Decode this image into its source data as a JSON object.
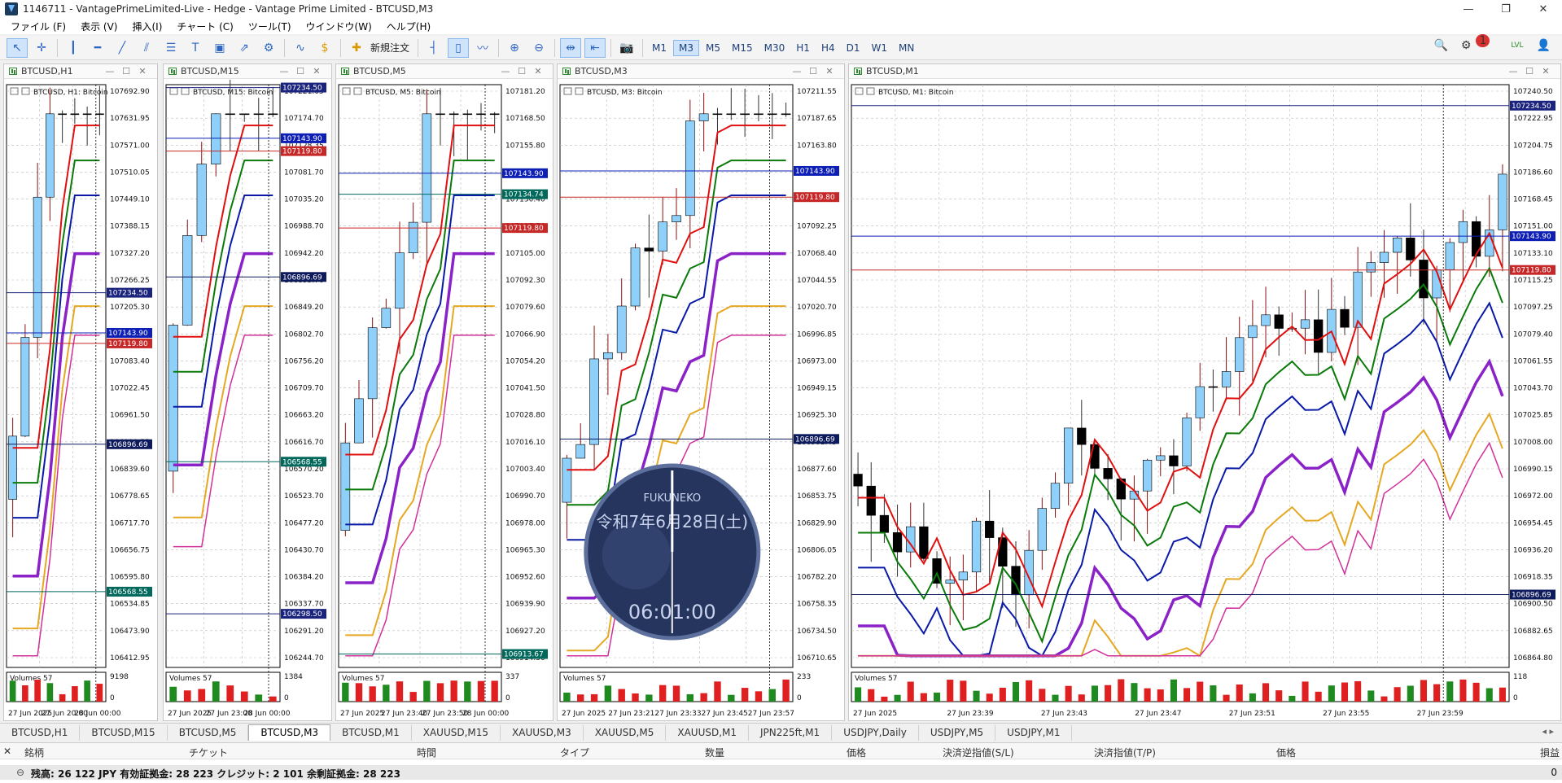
{
  "window": {
    "title": "1146711 - VantagePrimeLimited-Live - Hedge - Vantage Prime Limited - BTCUSD,M3",
    "minimize": "—",
    "maximize": "❐",
    "close": "✕"
  },
  "menu": [
    "ファイル (F)",
    "表示 (V)",
    "挿入(I)",
    "チャート (C)",
    "ツール(T)",
    "ウインドウ(W)",
    "ヘルプ(H)"
  ],
  "toolbar": {
    "new_order_label": "新規注文",
    "timeframes": [
      "M1",
      "M3",
      "M5",
      "M15",
      "M30",
      "H1",
      "H4",
      "D1",
      "W1",
      "MN"
    ],
    "active_timeframe": "M3",
    "notification_count": "1",
    "lvl_label": "LVL"
  },
  "charts": [
    {
      "window_title": "BTCUSD,H1",
      "sub_title": "BTCUSD, H1:  Bitcoin",
      "prices": [
        "107692.90",
        "107631.95",
        "107571.00",
        "107510.05",
        "107449.10",
        "107388.15",
        "107327.20",
        "107266.25",
        "107205.30",
        "107144.35",
        "107083.40",
        "107022.45",
        "106961.50",
        "106900.55",
        "106839.60",
        "106778.65",
        "106717.70",
        "106656.75",
        "106595.80",
        "106534.85",
        "106473.90",
        "106412.95"
      ],
      "tags": [
        {
          "t": "107234.50",
          "c": "#1a237e",
          "y": 0.357
        },
        {
          "t": "107143.90",
          "c": "#0d1fb5",
          "y": 0.426
        },
        {
          "t": "107119.80",
          "c": "#c62828",
          "y": 0.444
        },
        {
          "t": "106896.69",
          "c": "#0d1a5c",
          "y": 0.617
        },
        {
          "t": "106568.55",
          "c": "#00695c",
          "y": 0.87
        }
      ],
      "vol_label": "Volumes 57",
      "vol_max": "9198",
      "vol_min": "0",
      "times": [
        "27 Jun 2025",
        "27 Jun 20:00",
        "28 Jun 00:00"
      ]
    },
    {
      "window_title": "BTCUSD,M15",
      "sub_title": "BTCUSD, M15:  Bitcoin",
      "prices": [
        "107221.05",
        "107174.70",
        "107128.35",
        "107081.70",
        "107035.20",
        "106988.70",
        "106942.20",
        "106895.70",
        "106849.20",
        "106802.70",
        "106756.20",
        "106709.70",
        "106663.20",
        "106616.70",
        "106570.20",
        "106523.70",
        "106477.20",
        "106430.70",
        "106384.20",
        "106337.70",
        "106291.20",
        "106244.70"
      ],
      "tags": [
        {
          "t": "107234.50",
          "c": "#1a237e",
          "y": 0.005
        },
        {
          "t": "107143.90",
          "c": "#0d1fb5",
          "y": 0.092
        },
        {
          "t": "107119.80",
          "c": "#c62828",
          "y": 0.114
        },
        {
          "t": "106896.69",
          "c": "#0d1a5c",
          "y": 0.33
        },
        {
          "t": "106568.55",
          "c": "#00695c",
          "y": 0.647
        },
        {
          "t": "106298.50",
          "c": "#1a237e",
          "y": 0.908
        }
      ],
      "vol_label": "Volumes 57",
      "vol_max": "1384",
      "vol_min": "0",
      "times": [
        "27 Jun 2025",
        "27 Jun 23:00",
        "28 Jun 00:00"
      ]
    },
    {
      "window_title": "BTCUSD,M5",
      "sub_title": "BTCUSD, M5:  Bitcoin",
      "prices": [
        "107181.20",
        "107168.50",
        "107155.80",
        "107143.10",
        "107130.40",
        "107117.70",
        "107105.00",
        "107092.30",
        "107079.60",
        "107066.90",
        "107054.20",
        "107041.50",
        "107028.80",
        "107016.10",
        "107003.40",
        "106990.70",
        "106978.00",
        "106965.30",
        "106952.60",
        "106939.90",
        "106927.20",
        "106914.50"
      ],
      "tags": [
        {
          "t": "107143.90",
          "c": "#0d1fb5",
          "y": 0.152
        },
        {
          "t": "107134.74",
          "c": "#00695c",
          "y": 0.188
        },
        {
          "t": "107119.80",
          "c": "#c62828",
          "y": 0.246
        },
        {
          "t": "106913.67",
          "c": "#00695c",
          "y": 0.977
        }
      ],
      "vol_label": "Volumes 57",
      "vol_max": "337",
      "vol_min": "0",
      "times": [
        "27 Jun 2025",
        "27 Jun 23:40",
        "27 Jun 23:50",
        "28 Jun 00:00"
      ]
    },
    {
      "window_title": "BTCUSD,M3",
      "sub_title": "BTCUSD, M3:  Bitcoin",
      "prices": [
        "107211.55",
        "107187.65",
        "107163.80",
        "107139.85",
        "107116.00",
        "107092.25",
        "107068.40",
        "107044.55",
        "107020.70",
        "106996.85",
        "106973.00",
        "106949.15",
        "106925.30",
        "106901.45",
        "106877.60",
        "106853.75",
        "106829.90",
        "106806.05",
        "106782.20",
        "106758.35",
        "106734.50",
        "106710.65"
      ],
      "tags": [
        {
          "t": "107143.90",
          "c": "#0d1fb5",
          "y": 0.148
        },
        {
          "t": "107119.80",
          "c": "#c62828",
          "y": 0.193
        },
        {
          "t": "106896.69",
          "c": "#0d1a5c",
          "y": 0.608
        }
      ],
      "vol_label": "Volumes 57",
      "vol_max": "233",
      "vol_min": "0",
      "times": [
        "27 Jun 2025",
        "27 Jun 23:21",
        "27 Jun 23:33",
        "27 Jun 23:45",
        "27 Jun 23:57"
      ]
    },
    {
      "window_title": "BTCUSD,M1",
      "sub_title": "BTCUSD, M1:  Bitcoin",
      "prices": [
        "107240.50",
        "107222.95",
        "107204.75",
        "107186.60",
        "107168.45",
        "107151.00",
        "107133.10",
        "107115.25",
        "107097.25",
        "107079.40",
        "107061.55",
        "107043.70",
        "107025.85",
        "107008.00",
        "106990.15",
        "106972.00",
        "106954.45",
        "106936.20",
        "106918.35",
        "106900.50",
        "106882.65",
        "106864.80"
      ],
      "tags": [
        {
          "t": "107234.50",
          "c": "#1a237e",
          "y": 0.036
        },
        {
          "t": "107143.90",
          "c": "#0d1fb5",
          "y": 0.26
        },
        {
          "t": "107119.80",
          "c": "#c62828",
          "y": 0.318
        },
        {
          "t": "106896.69",
          "c": "#0d1a5c",
          "y": 0.875
        }
      ],
      "vol_label": "Volumes 57",
      "vol_max": "118",
      "vol_min": "0",
      "times": [
        "27 Jun 2025",
        "27 Jun 23:39",
        "27 Jun 23:43",
        "27 Jun 23:47",
        "27 Jun 23:51",
        "27 Jun 23:55",
        "27 Jun 23:59"
      ]
    }
  ],
  "clock": {
    "brand": "FUKUNEKO",
    "date": "令和7年6月28日(土)",
    "time": "06:01:00"
  },
  "tabs": [
    "BTCUSD,H1",
    "BTCUSD,M15",
    "BTCUSD,M5",
    "BTCUSD,M3",
    "BTCUSD,M1",
    "XAUUSD,M15",
    "XAUUSD,M3",
    "XAUUSD,M5",
    "XAUUSD,M1",
    "JPN225ft,M1",
    "USDJPY,Daily",
    "USDJPY,M5",
    "USDJPY,M1"
  ],
  "active_tab": "BTCUSD,M3",
  "terminal": {
    "columns": [
      "銘柄",
      "チケット",
      "時間",
      "タイプ",
      "数量",
      "価格",
      "決済逆指値(S/L)",
      "決済指値(T/P)",
      "価格",
      "損益"
    ],
    "summary": "残高: 26 122 JPY  有効証拠金: 28 223  クレジット: 2 101  余剰証拠金: 28 223",
    "profit": "0"
  },
  "colors": {
    "bull": "#8fd0fb",
    "bear": "#000000",
    "vol_up": "#1f8a1f",
    "vol_down": "#e02020",
    "ma_red": "#e01010",
    "ma_green": "#0a7a0a",
    "ma_navy": "#0a1aa8",
    "ma_purple": "#8a22c8",
    "ma_orange": "#e5a822",
    "ma_pink": "#d2309a"
  }
}
